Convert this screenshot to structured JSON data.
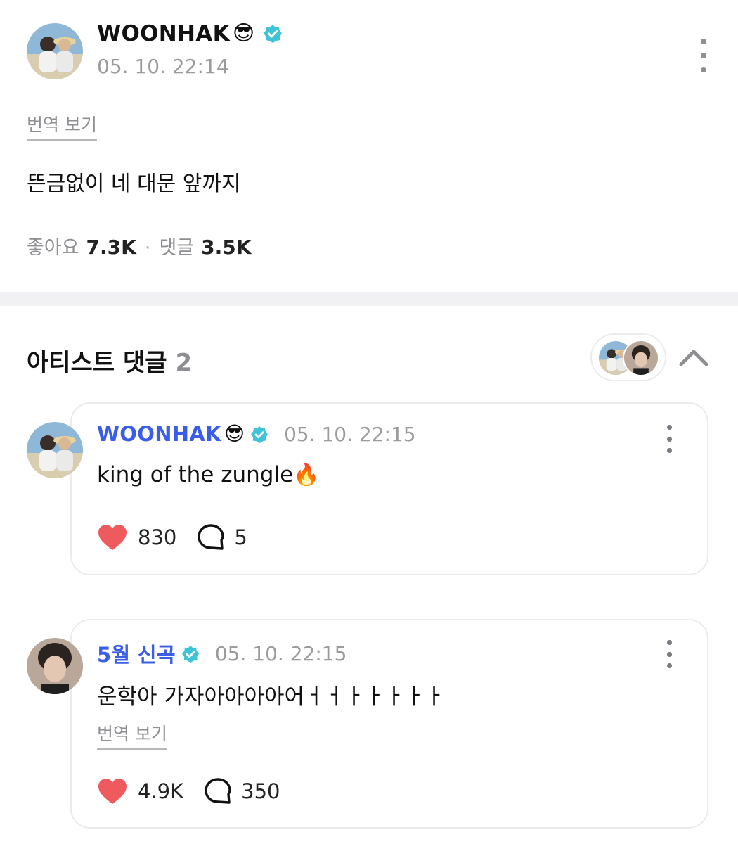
{
  "post": {
    "author": "WOONHAK",
    "author_emoji": "😎",
    "timestamp": "05. 10. 22:14",
    "translate_label": "번역 보기",
    "body": "뜬금없이 네 대문 앞까지",
    "likes_label": "좋아요",
    "likes_count": "7.3K",
    "separator": "·",
    "comments_label": "댓글",
    "comments_count": "3.5K"
  },
  "artist_comments": {
    "title": "아티스트 댓글",
    "count": "2",
    "items": [
      {
        "author": "WOONHAK",
        "author_emoji": "😎",
        "timestamp": "05. 10. 22:15",
        "body": "king of the zungle",
        "body_emoji": "🔥",
        "likes": "830",
        "replies": "5"
      },
      {
        "author": "5월 신곡",
        "timestamp": "05. 10. 22:15",
        "body": "운학아 가자아아아아어ㅓㅓㅏㅏㅏㅏㅏ",
        "translate_label": "번역 보기",
        "likes": "4.9K",
        "replies": "350"
      }
    ]
  },
  "colors": {
    "accent_name": "#3b5ee6",
    "verified": "#3ec3d8",
    "heart": "#ef5a5f",
    "muted": "#8e8e93"
  },
  "icons": [
    "verified-badge-icon",
    "more-vertical-icon",
    "chevron-up-icon",
    "heart-icon",
    "reply-bubble-icon"
  ]
}
